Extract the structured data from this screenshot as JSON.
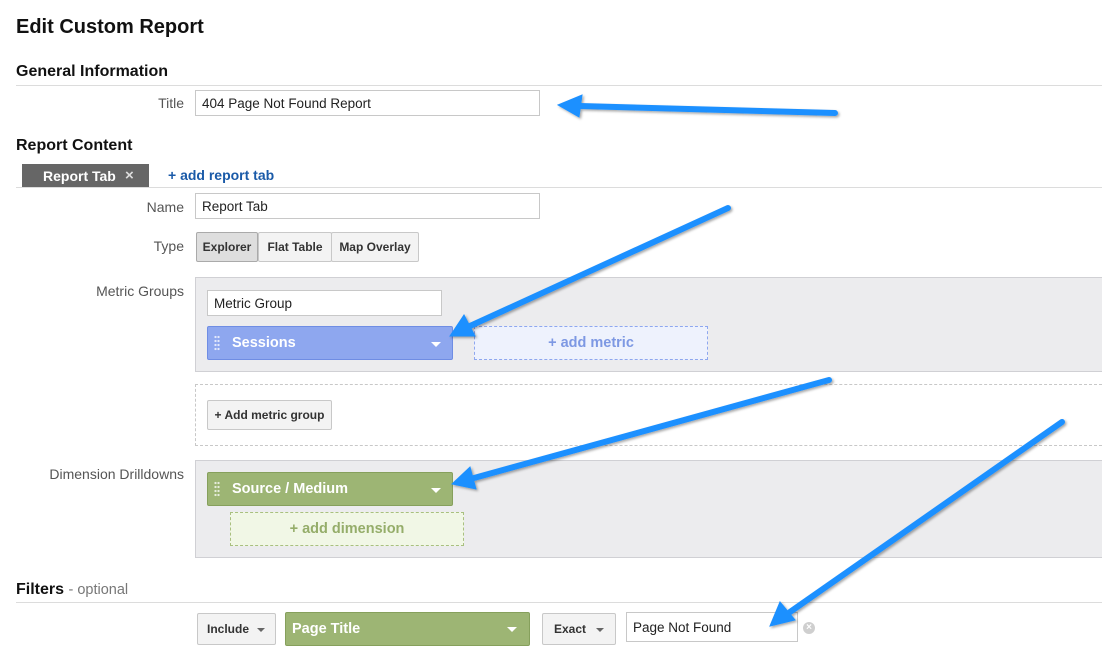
{
  "page": {
    "title": "Edit Custom Report"
  },
  "general": {
    "heading": "General Information",
    "title_label": "Title",
    "title_value": "404 Page Not Found Report"
  },
  "content": {
    "heading": "Report Content",
    "tab_label": "Report Tab",
    "tab_close": "×",
    "add_tab": "+ add report tab",
    "name_label": "Name",
    "name_value": "Report Tab",
    "type_label": "Type",
    "type_options": [
      "Explorer",
      "Flat Table",
      "Map Overlay"
    ],
    "type_selected": "Explorer",
    "metric_groups_label": "Metric Groups",
    "metric_group_name": "Metric Group",
    "metric": "Sessions",
    "add_metric": "+ add metric",
    "add_metric_group": "+ Add metric group",
    "dimension_label": "Dimension Drilldowns",
    "dimension": "Source / Medium",
    "add_dimension": "+ add dimension"
  },
  "filters": {
    "heading": "Filters",
    "optional": "- optional",
    "include": "Include",
    "dimension": "Page Title",
    "match": "Exact",
    "value": "Page Not Found"
  },
  "colors": {
    "metric": "#8ea7ef",
    "dimension": "#9db574",
    "annotation_arrow": "#1e90ff"
  },
  "icons": {
    "tab_close": "close-icon",
    "grip": "drag-handle-icon",
    "dropdown": "chevron-down-icon",
    "clear": "clear-icon"
  }
}
